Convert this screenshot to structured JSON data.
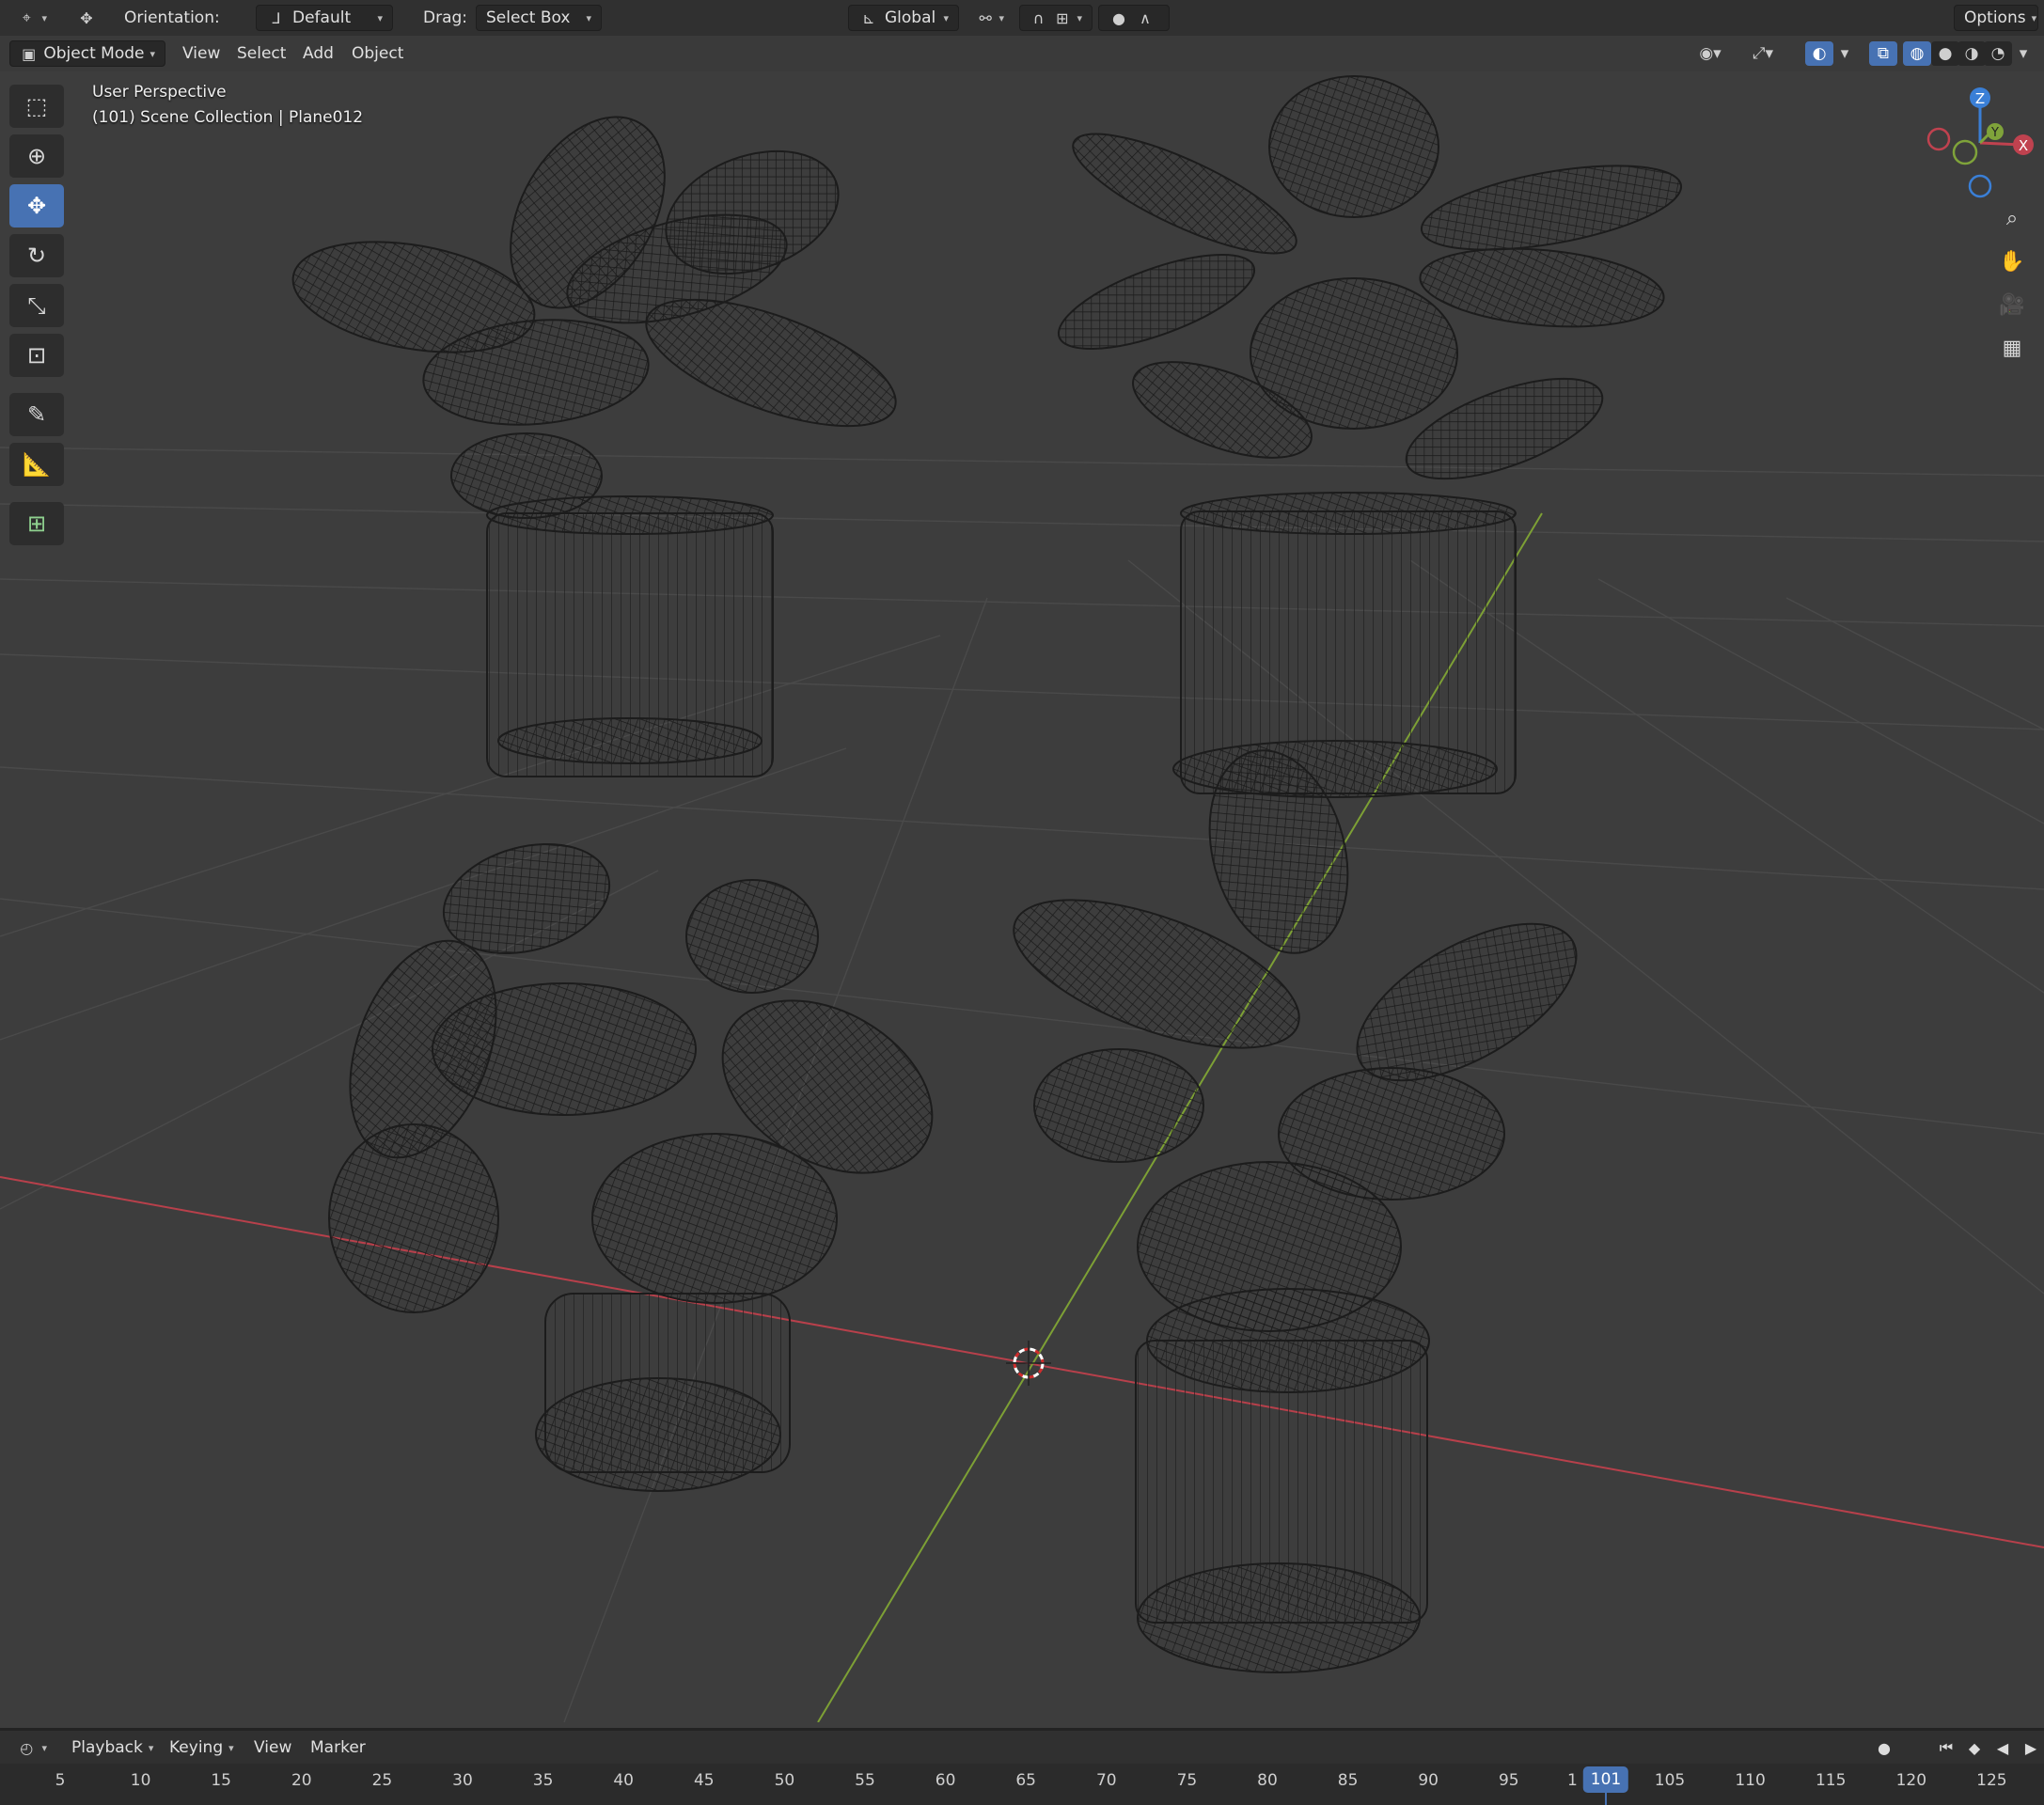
{
  "tool_header": {
    "orientation_label": "Orientation:",
    "orientation_value": "Default",
    "drag_label": "Drag:",
    "drag_value": "Select Box",
    "transform_orientation": "Global",
    "options_label": "Options"
  },
  "view_header": {
    "mode": "Object Mode",
    "menus": [
      "View",
      "Select",
      "Add",
      "Object"
    ]
  },
  "viewport": {
    "view_name": "User Perspective",
    "collection_info": "(101) Scene Collection | Plane012",
    "shading_mode": "wireframe"
  },
  "gizmo": {
    "z": "Z",
    "y": "Y",
    "x": "X"
  },
  "toolbar": {
    "tools": [
      "select-box",
      "cursor",
      "move",
      "rotate",
      "scale",
      "transform",
      "annotate",
      "measure",
      "add-cube"
    ],
    "active_tool": "move"
  },
  "timeline": {
    "menus": [
      "Playback",
      "Keying",
      "View",
      "Marker"
    ],
    "ticks": [
      "5",
      "10",
      "15",
      "20",
      "25",
      "30",
      "35",
      "40",
      "45",
      "50",
      "55",
      "60",
      "65",
      "70",
      "75",
      "80",
      "85",
      "90",
      "95",
      "1",
      "105",
      "110",
      "115",
      "120",
      "125"
    ],
    "current_frame": "101"
  },
  "colors": {
    "accent": "#4772b3",
    "x_axis": "#c0424f",
    "y_axis": "#7fa33a",
    "z_axis": "#3a7fd6",
    "viewport_bg": "#3d3d3d",
    "wire": "#1b1b1b"
  }
}
